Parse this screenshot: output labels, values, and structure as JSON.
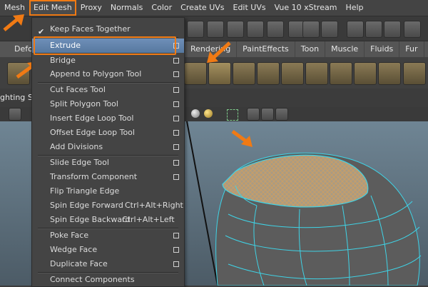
{
  "menubar": {
    "items": [
      "Mesh",
      "Edit Mesh",
      "Proxy",
      "Normals",
      "Color",
      "Create UVs",
      "Edit UVs",
      "Vue 10 xStream",
      "Help"
    ]
  },
  "tabs": {
    "left_partial": "Defo",
    "items": [
      "Rendering",
      "PaintEffects",
      "Toon",
      "Muscle",
      "Fluids",
      "Fur"
    ]
  },
  "panel": {
    "left_label": "ghting",
    "s_label": "S"
  },
  "edit_mesh_menu": {
    "items": [
      {
        "label": "Keep Faces Together",
        "checked": true,
        "option_box": false
      },
      {
        "label": "Extrude",
        "highlighted": true,
        "option_box": true
      },
      {
        "label": "Bridge",
        "option_box": true
      },
      {
        "label": "Append to Polygon Tool",
        "option_box": true
      },
      {
        "label": "Cut Faces Tool",
        "option_box": true
      },
      {
        "label": "Split Polygon Tool",
        "option_box": true
      },
      {
        "label": "Insert Edge Loop Tool",
        "option_box": true
      },
      {
        "label": "Offset Edge Loop Tool",
        "option_box": true
      },
      {
        "label": "Add Divisions",
        "option_box": true
      },
      {
        "label": "Slide Edge Tool",
        "option_box": true
      },
      {
        "label": "Transform Component",
        "option_box": true
      },
      {
        "label": "Flip Triangle Edge",
        "option_box": false
      },
      {
        "label": "Spin Edge Forward",
        "shortcut": "Ctrl+Alt+Right",
        "option_box": false
      },
      {
        "label": "Spin Edge Backward",
        "shortcut": "Ctrl+Alt+Left",
        "option_box": false
      },
      {
        "label": "Poke Face",
        "option_box": true
      },
      {
        "label": "Wedge Face",
        "option_box": true
      },
      {
        "label": "Duplicate Face",
        "option_box": true
      },
      {
        "label": "Connect Components",
        "option_box": false
      }
    ]
  },
  "colors": {
    "annotation_orange": "#f07a14",
    "highlight_blue": "#5f82ad",
    "wire_cyan": "#3fd3e6"
  },
  "icons": [
    "arrow-annotation-icon",
    "extrude-icon",
    "shelf-tool-icon"
  ]
}
